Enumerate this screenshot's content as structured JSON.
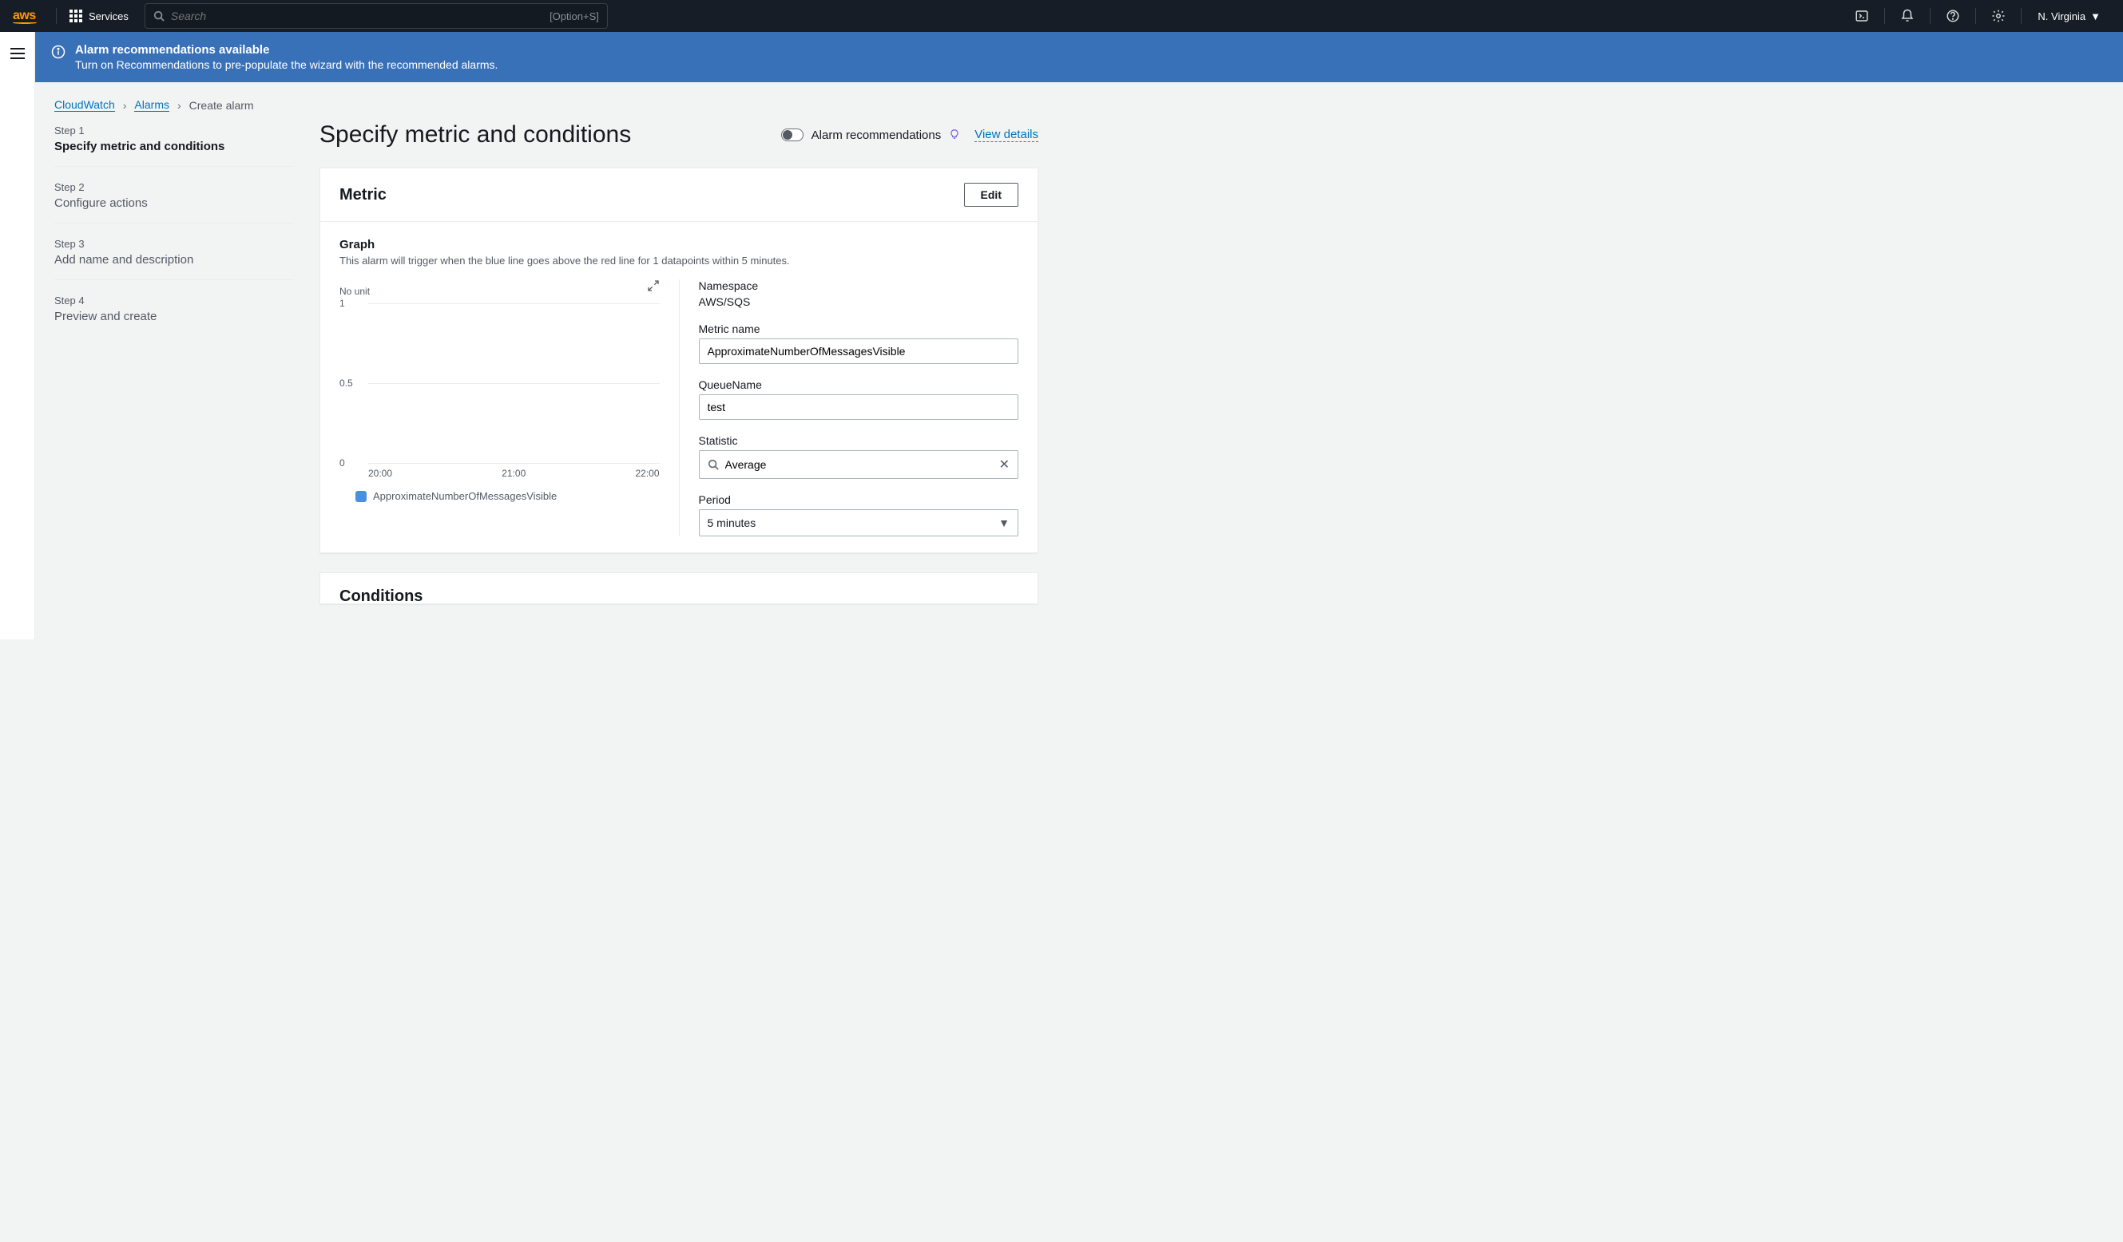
{
  "nav": {
    "logo": "aws",
    "services": "Services",
    "search_placeholder": "Search",
    "search_shortcut": "[Option+S]",
    "region": "N. Virginia"
  },
  "banner": {
    "title": "Alarm recommendations available",
    "text": "Turn on Recommendations to pre-populate the wizard with the recommended alarms."
  },
  "breadcrumb": {
    "root": "CloudWatch",
    "section": "Alarms",
    "current": "Create alarm"
  },
  "steps": [
    {
      "label": "Step 1",
      "name": "Specify metric and conditions",
      "active": true
    },
    {
      "label": "Step 2",
      "name": "Configure actions",
      "active": false
    },
    {
      "label": "Step 3",
      "name": "Add name and description",
      "active": false
    },
    {
      "label": "Step 4",
      "name": "Preview and create",
      "active": false
    }
  ],
  "page": {
    "title": "Specify metric and conditions",
    "toggle_label": "Alarm recommendations",
    "view_details": "View details"
  },
  "metric_panel": {
    "title": "Metric",
    "edit": "Edit",
    "graph_label": "Graph",
    "graph_desc": "This alarm will trigger when the blue line goes above the red line for 1 datapoints within 5 minutes.",
    "ylabel": "No unit",
    "legend": "ApproximateNumberOfMessagesVisible",
    "namespace_label": "Namespace",
    "namespace_value": "AWS/SQS",
    "metric_name_label": "Metric name",
    "metric_name_value": "ApproximateNumberOfMessagesVisible",
    "queue_label": "QueueName",
    "queue_value": "test",
    "statistic_label": "Statistic",
    "statistic_value": "Average",
    "period_label": "Period",
    "period_value": "5 minutes"
  },
  "next_panel": {
    "title": "Conditions"
  },
  "chart_data": {
    "type": "line",
    "title": "",
    "xlabel": "",
    "ylabel": "No unit",
    "ylim": [
      0,
      1
    ],
    "yticks": [
      0,
      0.5,
      1
    ],
    "categories": [
      "20:00",
      "21:00",
      "22:00"
    ],
    "series": [
      {
        "name": "ApproximateNumberOfMessagesVisible",
        "values": [
          null,
          null,
          null
        ],
        "color": "#4a90e2"
      }
    ]
  }
}
